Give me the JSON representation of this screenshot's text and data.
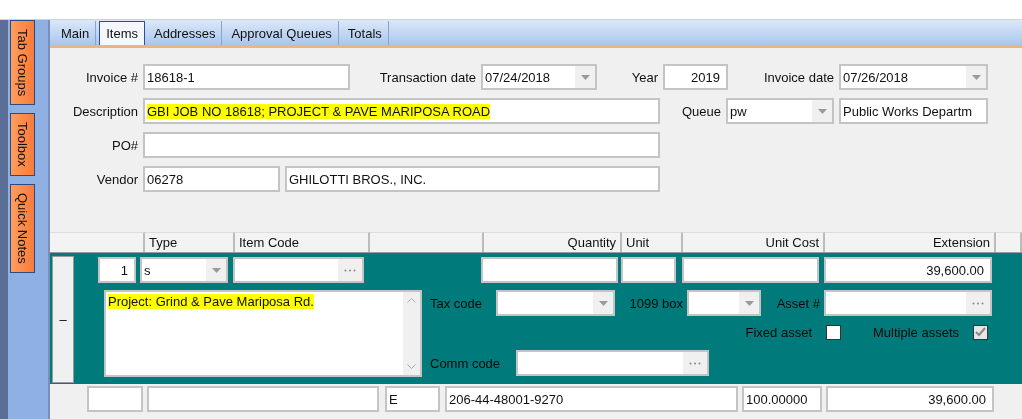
{
  "side_tabs": [
    {
      "label": "Tab Groups"
    },
    {
      "label": "Toolbox"
    },
    {
      "label": "Quick Notes"
    }
  ],
  "tabs": [
    {
      "label": "Main",
      "selected": false
    },
    {
      "label": "Items",
      "selected": true
    },
    {
      "label": "Addresses",
      "selected": false
    },
    {
      "label": "Approval Queues",
      "selected": false
    },
    {
      "label": "Totals",
      "selected": false
    }
  ],
  "header": {
    "invoice_number": {
      "label": "Invoice #",
      "value": "18618-1"
    },
    "transaction_date": {
      "label": "Transaction date",
      "value": "07/24/2018"
    },
    "year": {
      "label": "Year",
      "value": "2019"
    },
    "invoice_date": {
      "label": "Invoice date",
      "value": "07/26/2018"
    },
    "description": {
      "label": "Description",
      "value": "GBI JOB NO 18618; PROJECT & PAVE MARIPOSA ROAD",
      "highlighted": true
    },
    "queue": {
      "label": "Queue",
      "value": "pw",
      "name": "Public Works Departm"
    },
    "po": {
      "label": "PO#"
    },
    "vendor": {
      "label": "Vendor",
      "code": "06278",
      "name": "GHILOTTI BROS., INC."
    }
  },
  "grid": {
    "columns": [
      {
        "label": "Type"
      },
      {
        "label": "Item Code"
      },
      {
        "label": "Quantity"
      },
      {
        "label": "Unit"
      },
      {
        "label": "Unit Cost"
      },
      {
        "label": "Extension"
      }
    ],
    "item": {
      "toggle": "–",
      "line": "1",
      "type": "s",
      "extension": "39,600.00",
      "note": {
        "value": "Project: Grind & Pave Mariposa Rd.",
        "highlighted": true
      },
      "tax_code": {
        "label": "Tax code"
      },
      "box_1099": {
        "label": "1099 box"
      },
      "asset": {
        "label": "Asset #"
      },
      "fixed_asset": {
        "label": "Fixed asset",
        "checked": false,
        "disabled": false
      },
      "multiple_assets": {
        "label": "Multiple assets",
        "checked": true,
        "disabled": true
      },
      "comm_code": {
        "label": "Comm code"
      }
    },
    "distribution": {
      "code": "E",
      "account": "206-44-48001-9270",
      "share": "100.00000",
      "amount": "39,600.00"
    }
  }
}
